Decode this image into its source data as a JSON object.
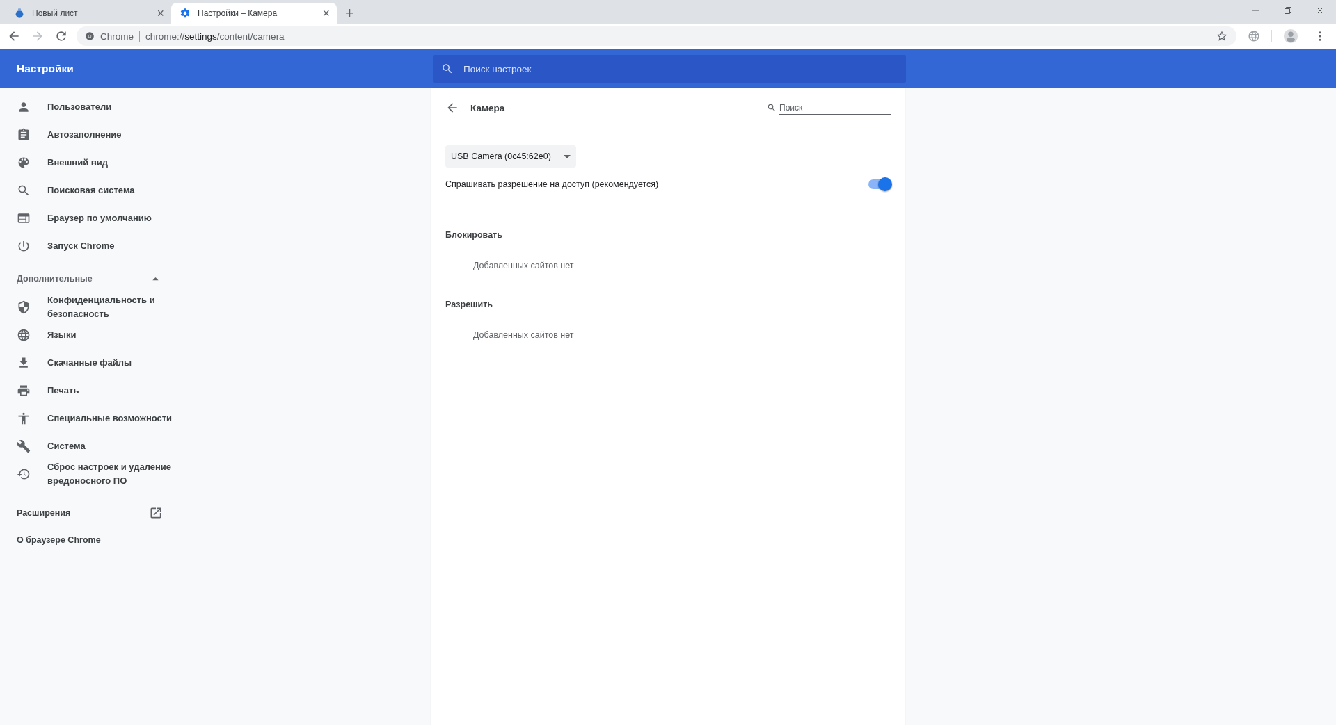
{
  "tabs": [
    {
      "title": "Новый лист",
      "selected": false,
      "close": "×"
    },
    {
      "title": "Настройки – Камера",
      "selected": true,
      "close": "×"
    }
  ],
  "new_tab": "+",
  "omnibox": {
    "site_label": "Chrome",
    "url": {
      "scheme": "chrome://",
      "host": "settings",
      "path": "/content/camera"
    }
  },
  "header": {
    "title": "Настройки",
    "search_placeholder": "Поиск настроек"
  },
  "sidebar": {
    "items": [
      {
        "label": "Пользователи"
      },
      {
        "label": "Автозаполнение"
      },
      {
        "label": "Внешний вид"
      },
      {
        "label": "Поисковая система"
      },
      {
        "label": "Браузер по умолчанию"
      },
      {
        "label": "Запуск Chrome"
      }
    ],
    "advanced": {
      "label": "Дополнительные",
      "expanded": true,
      "items": [
        {
          "label": "Конфиденциальность и безопасность"
        },
        {
          "label": "Языки"
        },
        {
          "label": "Скачанные файлы"
        },
        {
          "label": "Печать"
        },
        {
          "label": "Специальные возможности"
        },
        {
          "label": "Система"
        },
        {
          "label": "Сброс настроек и удаление вредоносного ПО"
        }
      ]
    },
    "extensions": "Расширения",
    "about": "О браузере Chrome"
  },
  "page": {
    "title": "Камера",
    "search_placeholder": "Поиск",
    "device": "USB Camera (0c45:62e0)",
    "ask_toggle": {
      "label": "Спрашивать разрешение на доступ (рекомендуется)",
      "on": true
    },
    "sections": [
      {
        "heading": "Блокировать",
        "empty": "Добавленных сайтов нет"
      },
      {
        "heading": "Разрешить",
        "empty": "Добавленных сайтов нет"
      }
    ]
  }
}
